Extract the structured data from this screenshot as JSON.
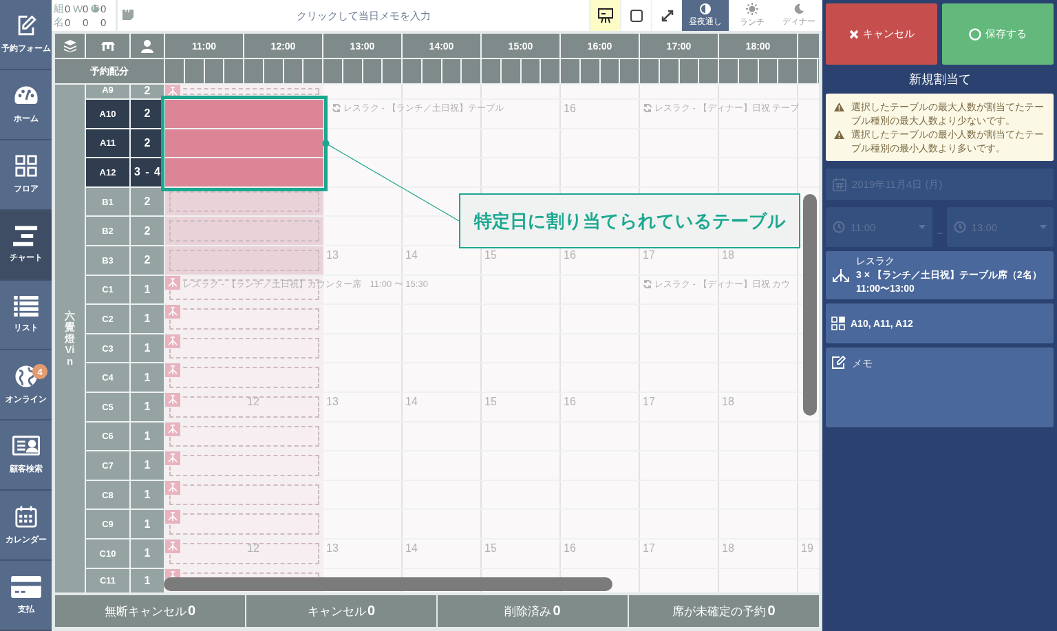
{
  "sidebar": {
    "items": [
      {
        "label": "予約フォーム",
        "selected": false
      },
      {
        "label": "ホーム",
        "selected": false
      },
      {
        "label": "フロア",
        "selected": false
      },
      {
        "label": "チャート",
        "selected": true
      },
      {
        "label": "リスト",
        "selected": false
      },
      {
        "label": "オンライン",
        "selected": false,
        "badge": "4"
      },
      {
        "label": "顧客検索",
        "selected": false
      },
      {
        "label": "カレンダー",
        "selected": false
      },
      {
        "label": "支払",
        "selected": false
      }
    ]
  },
  "counts": [
    {
      "label": "組",
      "marker": "W",
      "values": [
        "0",
        "0",
        "0"
      ]
    },
    {
      "label": "名",
      "values": [
        "0",
        "0",
        "0"
      ]
    }
  ],
  "day_memo": {
    "placeholder": "クリックして当日メモを入力"
  },
  "view_toggles": [
    {
      "on": true
    },
    {
      "on": false
    },
    {
      "on": false
    }
  ],
  "shift_tabs": [
    {
      "label": "昼夜通し",
      "selected": true
    },
    {
      "label": "ランチ",
      "selected": false
    },
    {
      "label": "ディナー",
      "selected": false
    }
  ],
  "chart": {
    "hours": [
      "11:00",
      "12:00",
      "13:00",
      "14:00",
      "15:00",
      "16:00",
      "17:00",
      "18:00"
    ],
    "allocation_label": "予約配分",
    "group": "六覺燈Vin",
    "rows": [
      {
        "table": "A9",
        "capacity": "2",
        "selected": false,
        "kind": "plan"
      },
      {
        "table": "A10",
        "capacity": "2",
        "selected": true,
        "kind": "assigned",
        "slots": {
          "13:00": {
            "kind": "recurring",
            "text": "レスラク - 【ランチ／土日祝】テーブル"
          },
          "16:00": {
            "kind": "hour",
            "text": "16"
          },
          "17:00": {
            "kind": "recurring",
            "text": "レスラク - 【ディナー】日祝 テーブ"
          }
        }
      },
      {
        "table": "A11",
        "capacity": "2",
        "selected": true,
        "kind": "assigned"
      },
      {
        "table": "A12",
        "capacity": "3 - 4",
        "selected": true,
        "kind": "assigned"
      },
      {
        "table": "B1",
        "capacity": "2",
        "selected": false,
        "kind": "tentative"
      },
      {
        "table": "B2",
        "capacity": "2",
        "selected": false,
        "kind": "tentative"
      },
      {
        "table": "B3",
        "capacity": "2",
        "selected": false,
        "kind": "tentative",
        "slots": {
          "13:00": {
            "kind": "hour",
            "text": "13"
          },
          "14:00": {
            "kind": "hour",
            "text": "14"
          },
          "15:00": {
            "kind": "hour",
            "text": "15"
          },
          "16:00": {
            "kind": "hour",
            "text": "16"
          },
          "17:00": {
            "kind": "hour",
            "text": "17"
          },
          "18:00": {
            "kind": "hour",
            "text": "18"
          }
        }
      },
      {
        "table": "C1",
        "capacity": "1",
        "selected": false,
        "kind": "plan",
        "slots": {
          "11:00": {
            "kind": "plan",
            "text": "レスラク - 【ランチ／土日祝】カウンター席　11:00 〜 15:30"
          },
          "17:00": {
            "kind": "recurring",
            "text": "レスラク - 【ディナー】日祝 カウ"
          }
        }
      },
      {
        "table": "C2",
        "capacity": "1",
        "selected": false,
        "kind": "plan"
      },
      {
        "table": "C3",
        "capacity": "1",
        "selected": false,
        "kind": "plan"
      },
      {
        "table": "C4",
        "capacity": "1",
        "selected": false,
        "kind": "plan"
      },
      {
        "table": "C5",
        "capacity": "1",
        "selected": false,
        "kind": "plan",
        "slots": {
          "12:00": {
            "kind": "hour",
            "text": "12"
          },
          "13:00": {
            "kind": "hour",
            "text": "13"
          },
          "14:00": {
            "kind": "hour",
            "text": "14"
          },
          "15:00": {
            "kind": "hour",
            "text": "15"
          },
          "16:00": {
            "kind": "hour",
            "text": "16"
          },
          "17:00": {
            "kind": "hour",
            "text": "17"
          },
          "18:00": {
            "kind": "hour",
            "text": "18"
          }
        }
      },
      {
        "table": "C6",
        "capacity": "1",
        "selected": false,
        "kind": "plan"
      },
      {
        "table": "C7",
        "capacity": "1",
        "selected": false,
        "kind": "plan"
      },
      {
        "table": "C8",
        "capacity": "1",
        "selected": false,
        "kind": "plan"
      },
      {
        "table": "C9",
        "capacity": "1",
        "selected": false,
        "kind": "plan"
      },
      {
        "table": "C10",
        "capacity": "1",
        "selected": false,
        "kind": "plan",
        "slots": {
          "12:00": {
            "kind": "hour",
            "text": "12"
          },
          "13:00": {
            "kind": "hour",
            "text": "13"
          },
          "14:00": {
            "kind": "hour",
            "text": "14"
          },
          "15:00": {
            "kind": "hour",
            "text": "15"
          },
          "16:00": {
            "kind": "hour",
            "text": "16"
          },
          "17:00": {
            "kind": "hour",
            "text": "17"
          },
          "18:00": {
            "kind": "hour",
            "text": "18"
          },
          "19:00": {
            "kind": "hour",
            "text": "19"
          }
        }
      },
      {
        "table": "C11",
        "capacity": "1",
        "selected": false,
        "kind": "plan"
      }
    ],
    "callout": "特定日に割り当てられているテーブル"
  },
  "status_bar": [
    {
      "label": "無断キャンセル",
      "count": "0"
    },
    {
      "label": "キャンセル",
      "count": "0"
    },
    {
      "label": "削除済み",
      "count": "0"
    },
    {
      "label": "席が未確定の予約",
      "count": "0"
    }
  ],
  "panel": {
    "cancel": "キャンセル",
    "save": "保存する",
    "title": "新規割当て",
    "warnings": [
      "選択したテーブルの最大人数が割当てたテーブル種別の最大人数より少ないです。",
      "選択したテーブルの最小人数が割当てたテーブル種別の最小人数より多いです。"
    ],
    "date": {
      "value": "2019年11月4日 (月)",
      "disabled": true
    },
    "start_time": {
      "value": "11:00",
      "disabled": true
    },
    "time_separator": "~",
    "end_time": {
      "value": "13:00",
      "disabled": true
    },
    "plan": {
      "name": "レスラク",
      "line": "**3** × **【ランチ／土日祝】テーブル席（2名）**",
      "time": "11:00〜13:00"
    },
    "tables": "A10, A11, A12",
    "memo": {
      "placeholder": "メモ"
    }
  }
}
